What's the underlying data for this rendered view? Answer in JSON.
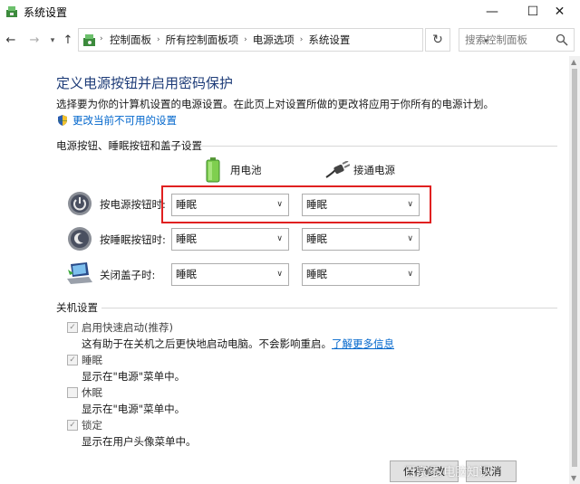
{
  "window": {
    "title": "系统设置",
    "minimize": "—",
    "maximize": "☐",
    "close": "✕"
  },
  "nav": {
    "back": "←",
    "forward": "→",
    "up": "↑"
  },
  "breadcrumb": [
    "控制面板",
    "所有控制面板项",
    "电源选项",
    "系统设置"
  ],
  "search": {
    "placeholder": "搜索控制面板"
  },
  "page": {
    "title": "定义电源按钮并启用密码保护",
    "description": "选择要为你的计算机设置的电源设置。在此页上对设置所做的更改将应用于你所有的电源计划。",
    "change_link": "更改当前不可用的设置"
  },
  "power_section": {
    "label": "电源按钮、睡眠按钮和盖子设置",
    "columns": {
      "battery": "用电池",
      "plugged": "接通电源"
    },
    "rows": [
      {
        "label": "按电源按钮时:",
        "battery": "睡眠",
        "plugged": "睡眠"
      },
      {
        "label": "按睡眠按钮时:",
        "battery": "睡眠",
        "plugged": "睡眠"
      },
      {
        "label": "关闭盖子时:",
        "battery": "睡眠",
        "plugged": "睡眠"
      }
    ]
  },
  "shutdown_section": {
    "label": "关机设置",
    "items": [
      {
        "label": "启用快速启动(推荐)",
        "checked": true,
        "desc": "这有助于在关机之后更快地启动电脑。不会影响重启。",
        "link": "了解更多信息"
      },
      {
        "label": "睡眠",
        "checked": true,
        "desc": "显示在\"电源\"菜单中。"
      },
      {
        "label": "休眠",
        "checked": false,
        "desc": "显示在\"电源\"菜单中。"
      },
      {
        "label": "锁定",
        "checked": true,
        "desc": "显示在用户头像菜单中。"
      }
    ]
  },
  "footer": {
    "save": "保存修改",
    "cancel": "取消"
  },
  "watermark": "百家号/电脑知识",
  "colors": {
    "title": "#1e3c78",
    "link": "#0066cc",
    "highlight": "#e02020"
  }
}
